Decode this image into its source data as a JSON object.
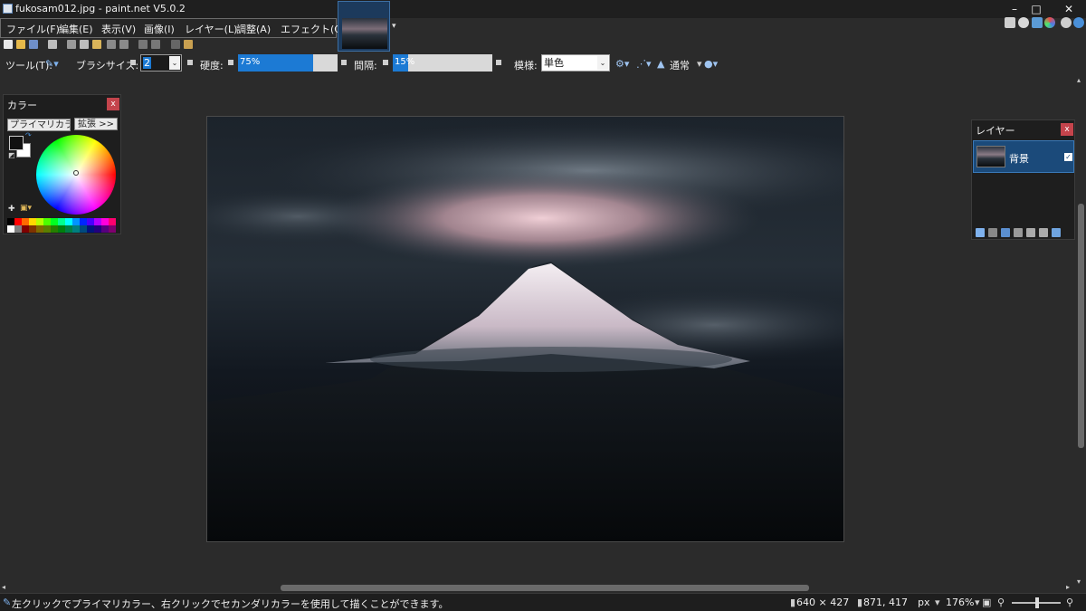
{
  "window": {
    "title": "fukosam012.jpg - paint.net V5.0.2",
    "minimize": "–",
    "maximize": "□",
    "close": "✕"
  },
  "menu": {
    "items": [
      "ファイル(F)",
      "編集(E)",
      "表示(V)",
      "画像(I)",
      "レイヤー(L)",
      "調整(A)",
      "エフェクト(C)"
    ]
  },
  "tool_options": {
    "tool_label": "ツール(T):",
    "brush_size_label": "ブラシサイズ:",
    "brush_size_value": "2",
    "hardness_label": "硬度:",
    "hardness_value": "75%",
    "hardness_percent": 75,
    "spacing_label": "間隔:",
    "spacing_value": "15%",
    "spacing_percent": 15,
    "pattern_label": "模様:",
    "pattern_value": "単色",
    "blend_mode": "通常"
  },
  "colors_panel": {
    "title": "カラー",
    "close": "x",
    "primary_button": "プライマリカラー",
    "expand_button": "拡張 >>",
    "primary_color": "#111111",
    "secondary_color": "#ffffff"
  },
  "layers_panel": {
    "title": "レイヤー",
    "close": "x",
    "layers": [
      {
        "name": "背景",
        "visible": true,
        "selected": true
      }
    ]
  },
  "status_bar": {
    "hint": "左クリックでプライマリカラー、右クリックでセカンダリカラーを使用して描くことができます。",
    "image_size": "640 × 427",
    "cursor_position": "871, 417",
    "unit": "px",
    "zoom": "176%"
  }
}
